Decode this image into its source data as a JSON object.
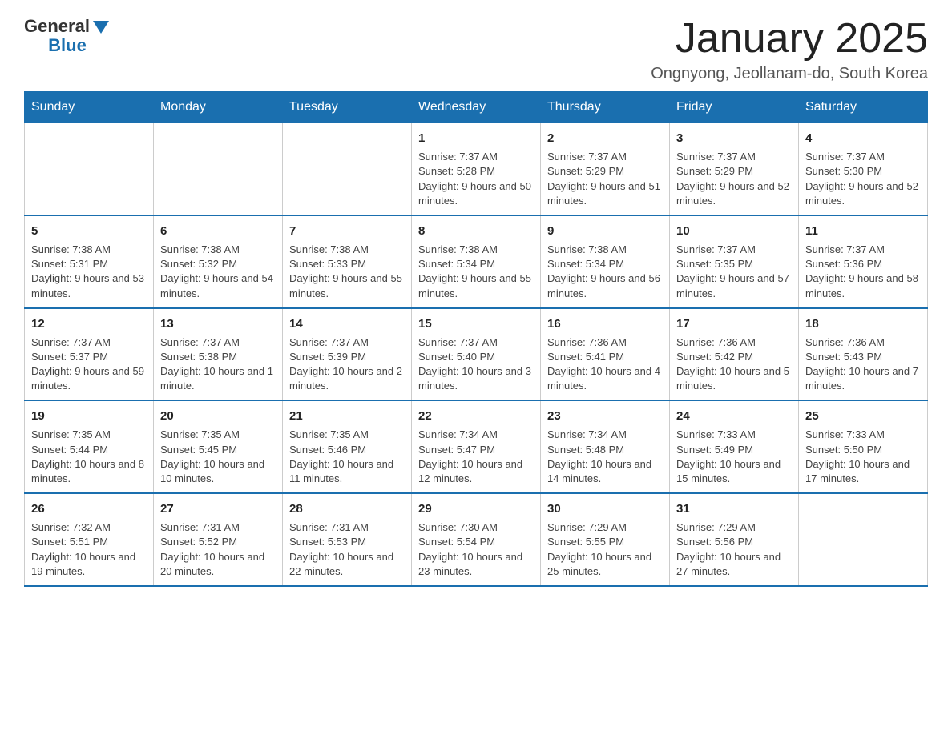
{
  "header": {
    "logo_general": "General",
    "logo_blue": "Blue",
    "month_title": "January 2025",
    "subtitle": "Ongnyong, Jeollanam-do, South Korea"
  },
  "days_of_week": [
    "Sunday",
    "Monday",
    "Tuesday",
    "Wednesday",
    "Thursday",
    "Friday",
    "Saturday"
  ],
  "weeks": [
    [
      {
        "day": "",
        "info": ""
      },
      {
        "day": "",
        "info": ""
      },
      {
        "day": "",
        "info": ""
      },
      {
        "day": "1",
        "info": "Sunrise: 7:37 AM\nSunset: 5:28 PM\nDaylight: 9 hours and 50 minutes."
      },
      {
        "day": "2",
        "info": "Sunrise: 7:37 AM\nSunset: 5:29 PM\nDaylight: 9 hours and 51 minutes."
      },
      {
        "day": "3",
        "info": "Sunrise: 7:37 AM\nSunset: 5:29 PM\nDaylight: 9 hours and 52 minutes."
      },
      {
        "day": "4",
        "info": "Sunrise: 7:37 AM\nSunset: 5:30 PM\nDaylight: 9 hours and 52 minutes."
      }
    ],
    [
      {
        "day": "5",
        "info": "Sunrise: 7:38 AM\nSunset: 5:31 PM\nDaylight: 9 hours and 53 minutes."
      },
      {
        "day": "6",
        "info": "Sunrise: 7:38 AM\nSunset: 5:32 PM\nDaylight: 9 hours and 54 minutes."
      },
      {
        "day": "7",
        "info": "Sunrise: 7:38 AM\nSunset: 5:33 PM\nDaylight: 9 hours and 55 minutes."
      },
      {
        "day": "8",
        "info": "Sunrise: 7:38 AM\nSunset: 5:34 PM\nDaylight: 9 hours and 55 minutes."
      },
      {
        "day": "9",
        "info": "Sunrise: 7:38 AM\nSunset: 5:34 PM\nDaylight: 9 hours and 56 minutes."
      },
      {
        "day": "10",
        "info": "Sunrise: 7:37 AM\nSunset: 5:35 PM\nDaylight: 9 hours and 57 minutes."
      },
      {
        "day": "11",
        "info": "Sunrise: 7:37 AM\nSunset: 5:36 PM\nDaylight: 9 hours and 58 minutes."
      }
    ],
    [
      {
        "day": "12",
        "info": "Sunrise: 7:37 AM\nSunset: 5:37 PM\nDaylight: 9 hours and 59 minutes."
      },
      {
        "day": "13",
        "info": "Sunrise: 7:37 AM\nSunset: 5:38 PM\nDaylight: 10 hours and 1 minute."
      },
      {
        "day": "14",
        "info": "Sunrise: 7:37 AM\nSunset: 5:39 PM\nDaylight: 10 hours and 2 minutes."
      },
      {
        "day": "15",
        "info": "Sunrise: 7:37 AM\nSunset: 5:40 PM\nDaylight: 10 hours and 3 minutes."
      },
      {
        "day": "16",
        "info": "Sunrise: 7:36 AM\nSunset: 5:41 PM\nDaylight: 10 hours and 4 minutes."
      },
      {
        "day": "17",
        "info": "Sunrise: 7:36 AM\nSunset: 5:42 PM\nDaylight: 10 hours and 5 minutes."
      },
      {
        "day": "18",
        "info": "Sunrise: 7:36 AM\nSunset: 5:43 PM\nDaylight: 10 hours and 7 minutes."
      }
    ],
    [
      {
        "day": "19",
        "info": "Sunrise: 7:35 AM\nSunset: 5:44 PM\nDaylight: 10 hours and 8 minutes."
      },
      {
        "day": "20",
        "info": "Sunrise: 7:35 AM\nSunset: 5:45 PM\nDaylight: 10 hours and 10 minutes."
      },
      {
        "day": "21",
        "info": "Sunrise: 7:35 AM\nSunset: 5:46 PM\nDaylight: 10 hours and 11 minutes."
      },
      {
        "day": "22",
        "info": "Sunrise: 7:34 AM\nSunset: 5:47 PM\nDaylight: 10 hours and 12 minutes."
      },
      {
        "day": "23",
        "info": "Sunrise: 7:34 AM\nSunset: 5:48 PM\nDaylight: 10 hours and 14 minutes."
      },
      {
        "day": "24",
        "info": "Sunrise: 7:33 AM\nSunset: 5:49 PM\nDaylight: 10 hours and 15 minutes."
      },
      {
        "day": "25",
        "info": "Sunrise: 7:33 AM\nSunset: 5:50 PM\nDaylight: 10 hours and 17 minutes."
      }
    ],
    [
      {
        "day": "26",
        "info": "Sunrise: 7:32 AM\nSunset: 5:51 PM\nDaylight: 10 hours and 19 minutes."
      },
      {
        "day": "27",
        "info": "Sunrise: 7:31 AM\nSunset: 5:52 PM\nDaylight: 10 hours and 20 minutes."
      },
      {
        "day": "28",
        "info": "Sunrise: 7:31 AM\nSunset: 5:53 PM\nDaylight: 10 hours and 22 minutes."
      },
      {
        "day": "29",
        "info": "Sunrise: 7:30 AM\nSunset: 5:54 PM\nDaylight: 10 hours and 23 minutes."
      },
      {
        "day": "30",
        "info": "Sunrise: 7:29 AM\nSunset: 5:55 PM\nDaylight: 10 hours and 25 minutes."
      },
      {
        "day": "31",
        "info": "Sunrise: 7:29 AM\nSunset: 5:56 PM\nDaylight: 10 hours and 27 minutes."
      },
      {
        "day": "",
        "info": ""
      }
    ]
  ]
}
